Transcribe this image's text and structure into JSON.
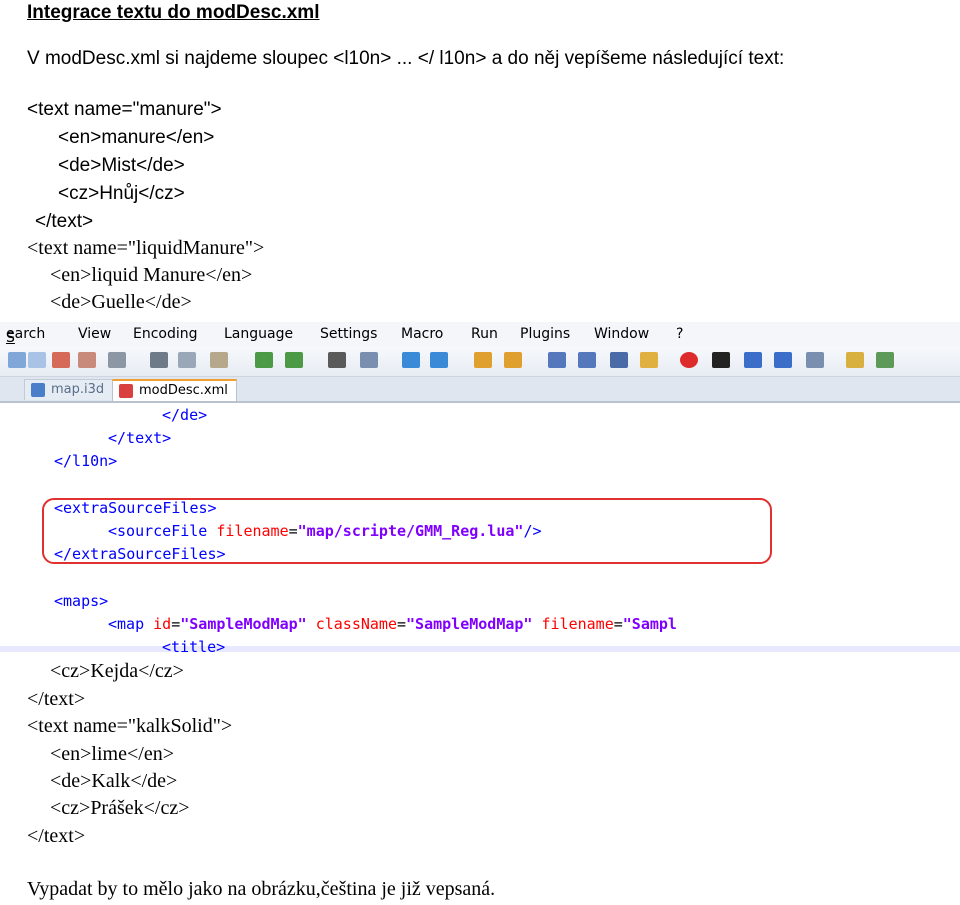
{
  "heading": "Integrace textu do modDesc.xml",
  "intro": "V modDesc.xml si najdeme sloupec <l10n> ... </ l10n> a do něj vepíšeme následující text:",
  "code_top": [
    "<text name=\"manure\">",
    "<en>manure</en>",
    "<de>Mist</de>",
    "<cz>Hnůj</cz>",
    "</text>",
    "<text name=\"liquidManure\">",
    "<en>liquid Manure</en>",
    "<de>Guelle</de>"
  ],
  "screenshot": {
    "menu": [
      "Search",
      "View",
      "Encoding",
      "Language",
      "Settings",
      "Macro",
      "Run",
      "Plugins",
      "Window",
      "?"
    ],
    "tabs": {
      "inactive": "map.i3d",
      "active": "modDesc.xml"
    },
    "editor": {
      "line1": "</de>",
      "line2": "</text>",
      "line3": "</l10n>",
      "extra_open": "<extraSourceFiles>",
      "source_tag": "<sourceFile",
      "source_attr": "filename",
      "source_eq": "=",
      "source_val": "\"map/scripte/GMM_Reg.lua\"",
      "source_close": "/>",
      "extra_close": "</extraSourceFiles>",
      "maps_open": "<maps>",
      "map_tag": "<map",
      "map_attr1": "id",
      "map_val1": "\"SampleModMap\"",
      "map_attr2": "className",
      "map_val2": "\"SampleModMap\"",
      "map_attr3": "filename",
      "map_val3": "\"Sampl",
      "title_tag": "<title>"
    }
  },
  "code_bottom": [
    "<cz>Kejda</cz>",
    "</text>",
    "<text name=\"kalkSolid\">",
    "<en>lime</en>",
    "<de>Kalk</de>",
    "<cz>Prášek</cz>",
    "</text>"
  ],
  "footer": "Vypadat by to mělo jako na obrázku,čeština je již vepsaná."
}
